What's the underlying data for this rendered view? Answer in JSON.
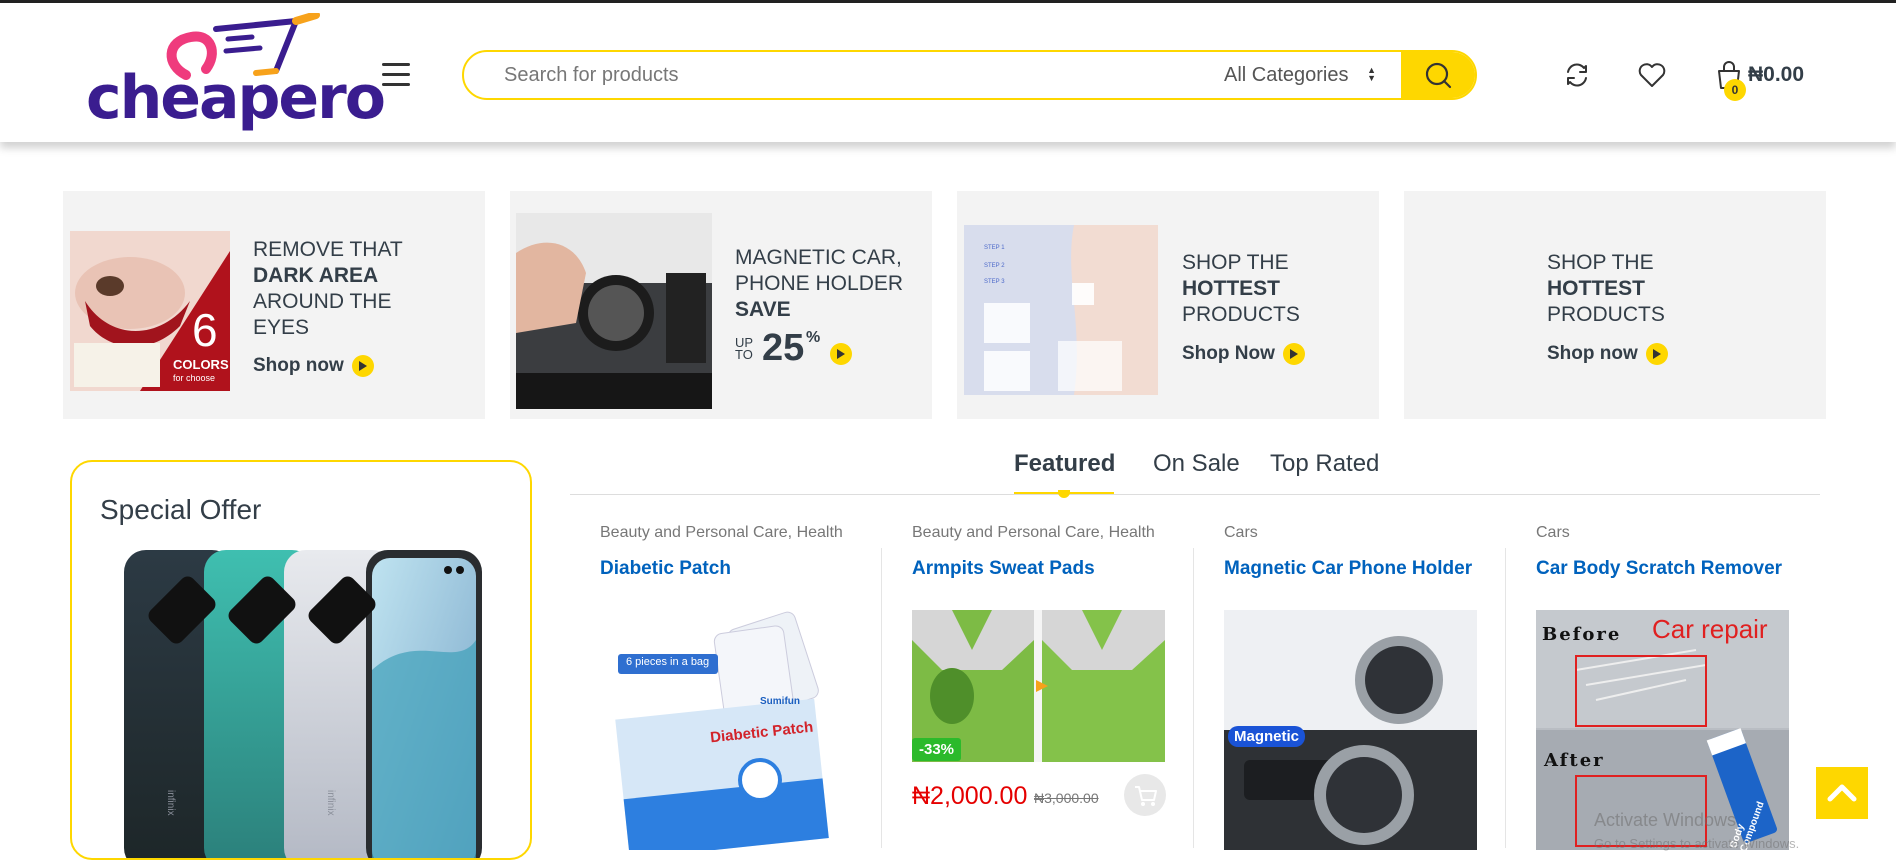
{
  "header": {
    "logo_text": "cheapero",
    "search": {
      "placeholder": "Search for products",
      "category": "All Categories"
    },
    "cart": {
      "total": "₦0.00",
      "count": "0"
    },
    "icons": [
      "menu-icon",
      "search-icon",
      "compare-icon",
      "heart-icon",
      "shopping-bag-icon"
    ],
    "accent_color": "#fed700"
  },
  "banners": [
    {
      "line1": "REMOVE THAT",
      "bold": "DARK AREA",
      "line3": "AROUND THE",
      "line4": "EYES",
      "cta": "Shop now",
      "img_text_big": "6",
      "img_text": "COLORS",
      "img_text_small": "for choose"
    },
    {
      "line1": "MAGNETIC CAR,",
      "line2": "PHONE HOLDER",
      "bold": "SAVE",
      "up": "UP",
      "to": "TO",
      "percent_value": "25",
      "percent_sign": "%"
    },
    {
      "line1": "SHOP THE",
      "bold": "HOTTEST",
      "line3": "PRODUCTS",
      "cta": "Shop Now"
    },
    {
      "line1": "SHOP THE",
      "bold": "HOTTEST",
      "line3": "PRODUCTS",
      "cta": "Shop now"
    }
  ],
  "special_offer": {
    "title": "Special Offer",
    "brand_text": "infinix"
  },
  "tabs": [
    "Featured",
    "On Sale",
    "Top Rated"
  ],
  "products": [
    {
      "category": "Beauty and Personal Care, Health",
      "name": "Diabetic Patch",
      "img_label": "6 pieces in a bag",
      "img_brand": "Sumifun",
      "img_title": "Diabetic Patch"
    },
    {
      "category": "Beauty and Personal Care, Health",
      "name": "Armpits Sweat Pads",
      "discount": "-33%",
      "price": "₦2,000.00",
      "old_price": "₦3,000.00"
    },
    {
      "category": "Cars",
      "name": "Magnetic Car Phone Holder",
      "img_label": "Magnetic"
    },
    {
      "category": "Cars",
      "name": "Car Body Scratch Remover",
      "img_before": "Before",
      "img_repair": "Car repair",
      "img_after": "After",
      "img_tube": "Body Compound"
    }
  ],
  "watermark": {
    "line1": "Activate Windows",
    "line2": "Go to Settings to activate Windows."
  }
}
